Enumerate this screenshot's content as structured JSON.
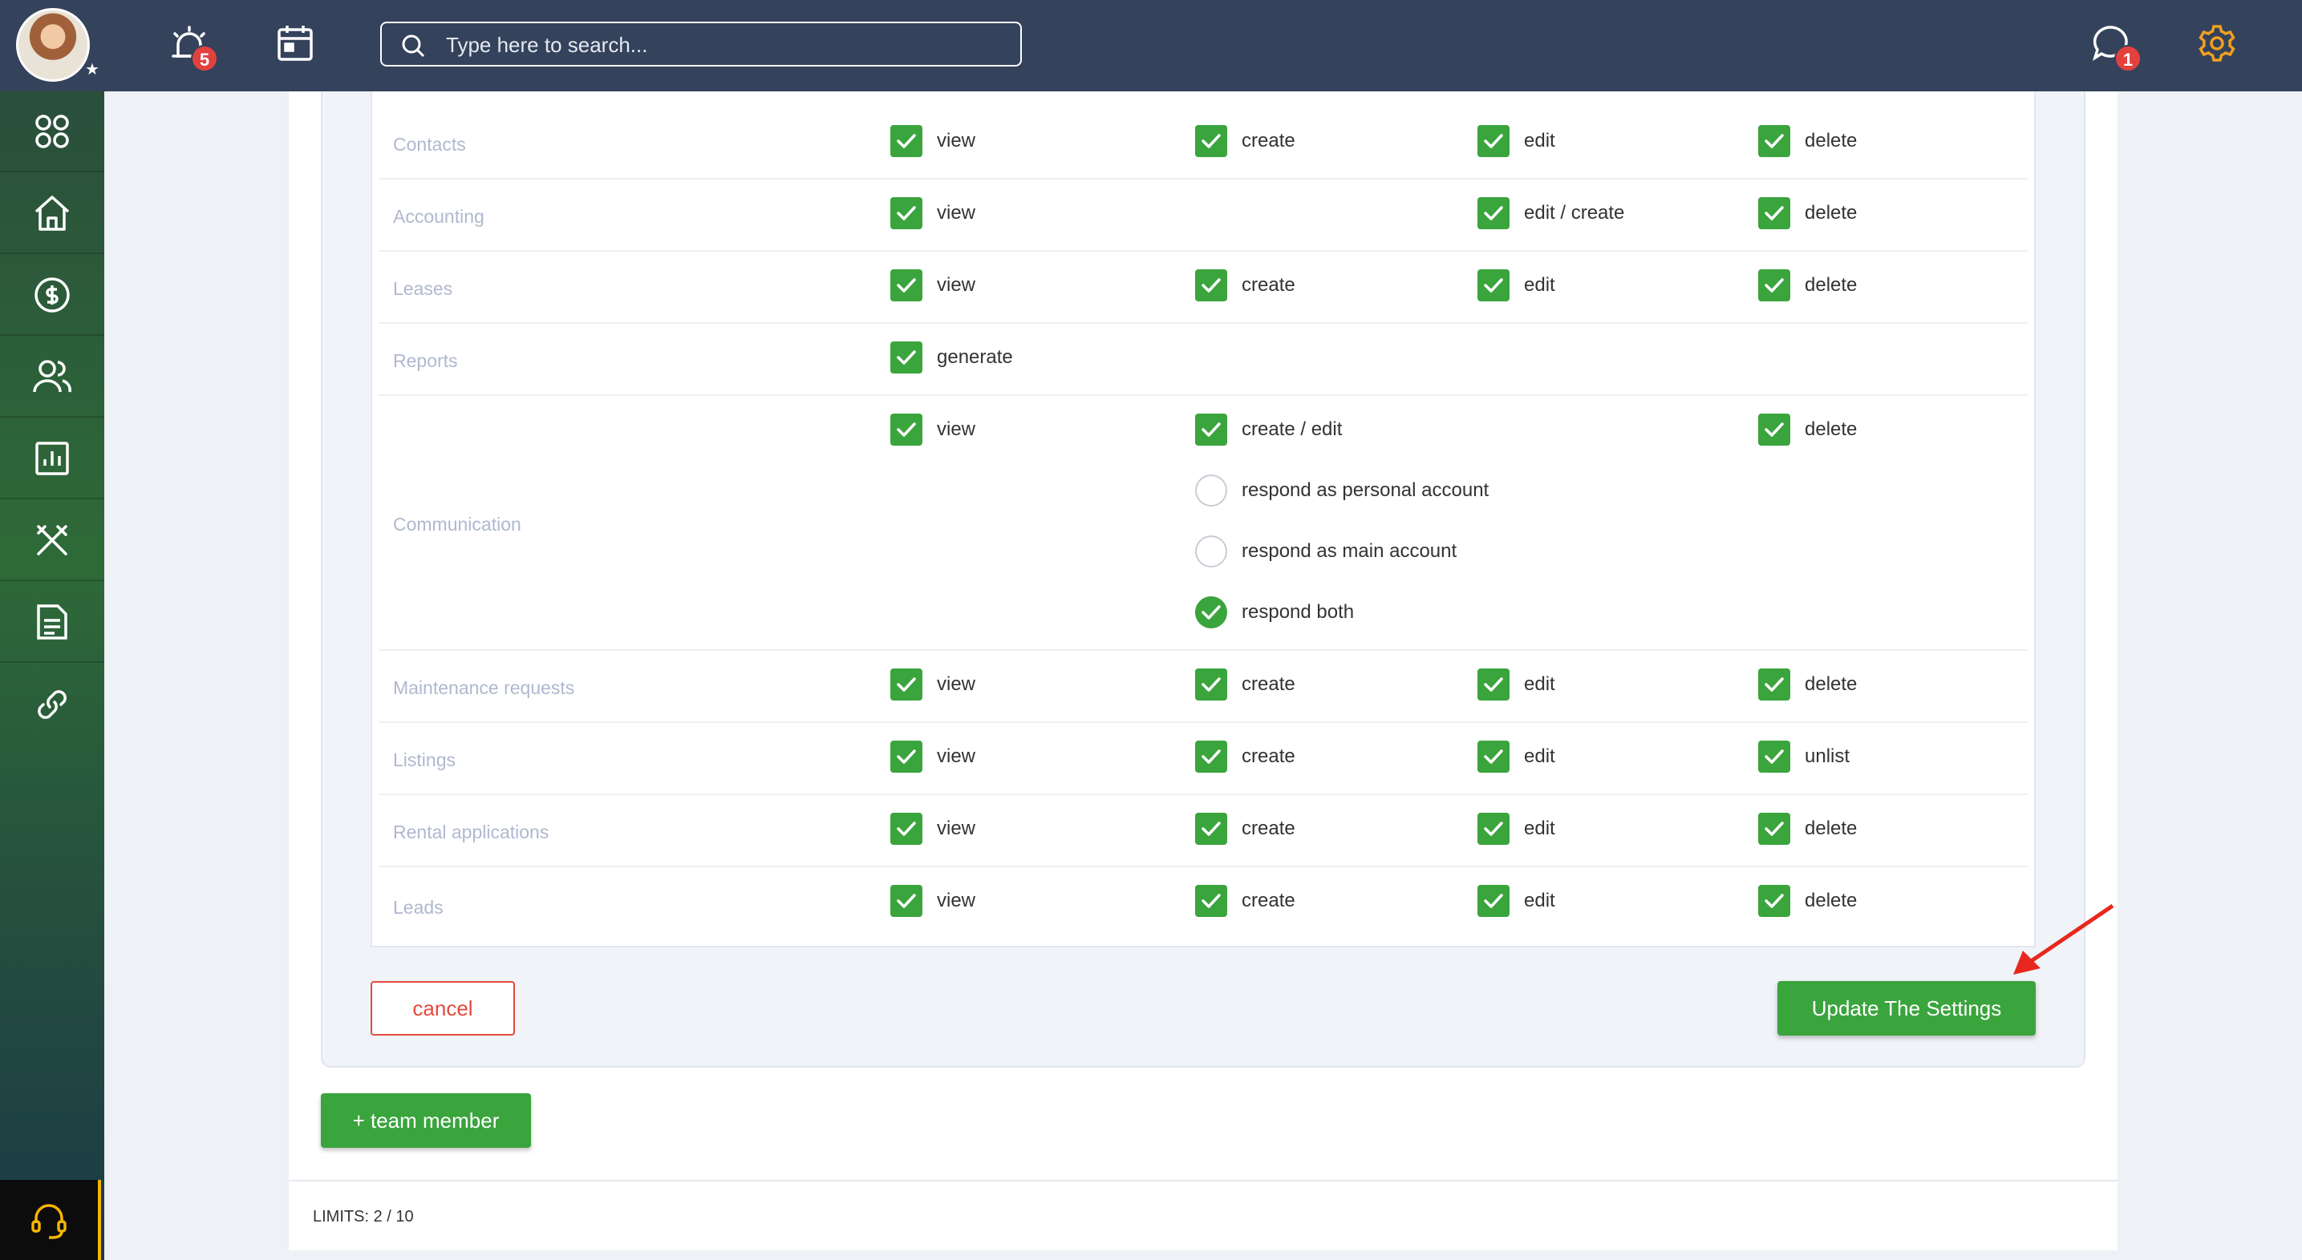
{
  "header": {
    "notifications_badge": "5",
    "messages_badge": "1",
    "search_placeholder": "Type here to search..."
  },
  "sidebar": {
    "items": [
      "dashboard-grid-icon",
      "home-icon",
      "dollar-icon",
      "users-icon",
      "chart-icon",
      "tools-icon",
      "document-icon",
      "link-icon"
    ],
    "support": "headset-icon"
  },
  "permissions": [
    {
      "label": "Contacts",
      "cols": [
        "view",
        "create",
        "edit",
        "delete"
      ]
    },
    {
      "label": "Accounting",
      "cols": [
        "view",
        "",
        "edit / create",
        "delete"
      ]
    },
    {
      "label": "Leases",
      "cols": [
        "view",
        "create",
        "edit",
        "delete"
      ]
    },
    {
      "label": "Reports",
      "cols": [
        "generate",
        "",
        "",
        ""
      ]
    },
    {
      "label": "Communication",
      "cols": [
        "view",
        "create / edit",
        "",
        "delete"
      ],
      "respond_options": [
        {
          "label": "respond as personal account",
          "selected": false
        },
        {
          "label": "respond as main account",
          "selected": false
        },
        {
          "label": "respond both",
          "selected": true
        }
      ]
    },
    {
      "label": "Maintenance requests",
      "cols": [
        "view",
        "create",
        "edit",
        "delete"
      ]
    },
    {
      "label": "Listings",
      "cols": [
        "view",
        "create",
        "edit",
        "unlist"
      ]
    },
    {
      "label": "Rental applications",
      "cols": [
        "view",
        "create",
        "edit",
        "delete"
      ]
    },
    {
      "label": "Leads",
      "cols": [
        "view",
        "create",
        "edit",
        "delete"
      ]
    }
  ],
  "buttons": {
    "cancel": "cancel",
    "update": "Update The Settings",
    "add_team_member": "+ team member"
  },
  "footer": {
    "limits": "LIMITS: 2 / 10"
  },
  "colors": {
    "topbar": "#34425c",
    "accent_green": "#3aa43d",
    "cancel_red": "#e24a3f",
    "gear_orange": "#f0a020"
  }
}
